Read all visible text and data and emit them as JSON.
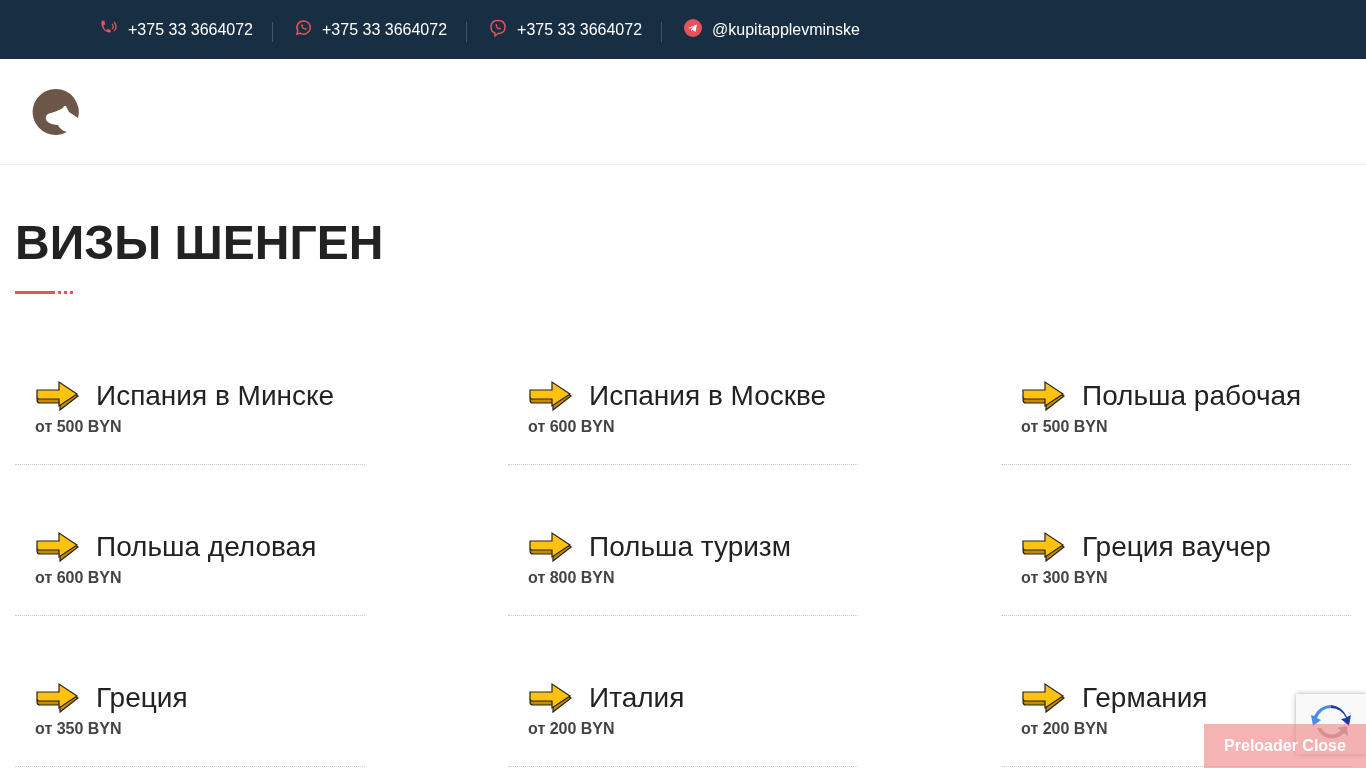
{
  "topbar": [
    {
      "kind": "phone",
      "text": "+375 33 3664072"
    },
    {
      "kind": "whatsapp",
      "text": "+375 33 3664072"
    },
    {
      "kind": "viber",
      "text": "+375 33 3664072"
    },
    {
      "kind": "telegram",
      "text": "@kupitapplevminske"
    }
  ],
  "title": "ВИЗЫ ШЕНГЕН",
  "items": [
    {
      "name": "Испания в Минске",
      "price": "от 500 BYN"
    },
    {
      "name": "Испания в Москве",
      "price": "от 600 BYN"
    },
    {
      "name": "Польша рабочая",
      "price": "от 500 BYN"
    },
    {
      "name": "Польша деловая",
      "price": "от 600 BYN"
    },
    {
      "name": "Польша туризм",
      "price": "от 800 BYN"
    },
    {
      "name": "Греция ваучер",
      "price": "от 300 BYN"
    },
    {
      "name": "Греция",
      "price": "от 350 BYN"
    },
    {
      "name": "Италия",
      "price": "от 200 BYN"
    },
    {
      "name": "Германия",
      "price": "от 200 BYN"
    }
  ],
  "preloader_button": "Preloader Close"
}
